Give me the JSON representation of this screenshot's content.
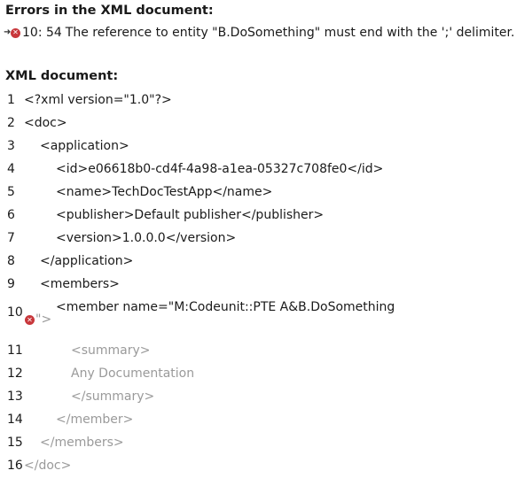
{
  "errors": {
    "heading": "Errors in the XML document:",
    "items": [
      {
        "position": "10: 54",
        "message": "The reference to entity \"B.DoSomething\" must end with the ';' delimiter."
      }
    ]
  },
  "xml": {
    "heading": "XML document:",
    "lines": [
      {
        "num": "1",
        "text": "<?xml version=\"1.0\"?>"
      },
      {
        "num": "2",
        "text": "<doc>"
      },
      {
        "num": "3",
        "text": "<application>"
      },
      {
        "num": "4",
        "text": "<id>e06618b0-cd4f-4a98-a1ea-05327c708fe0</id>"
      },
      {
        "num": "5",
        "text": "<name>TechDocTestApp</name>"
      },
      {
        "num": "6",
        "text": "<publisher>Default publisher</publisher>"
      },
      {
        "num": "7",
        "text": "<version>1.0.0.0</version>"
      },
      {
        "num": "8",
        "text": "</application>"
      },
      {
        "num": "9",
        "text": "<members>"
      },
      {
        "num": "10",
        "text": "<member name=\"M:Codeunit::PTE A&B.DoSomething",
        "tail": "\">"
      },
      {
        "num": "11",
        "text": "<summary>"
      },
      {
        "num": "12",
        "text": "Any Documentation"
      },
      {
        "num": "13",
        "text": "</summary>"
      },
      {
        "num": "14",
        "text": "</member>"
      },
      {
        "num": "15",
        "text": "</members>"
      },
      {
        "num": "16",
        "text": "</doc>"
      }
    ]
  },
  "icons": {
    "error": "error-circle-icon",
    "arrow": "arrow-right-icon"
  },
  "colors": {
    "error": "#c8373b",
    "text": "#1a1a1a",
    "dimmed": "#9a9a9a"
  }
}
